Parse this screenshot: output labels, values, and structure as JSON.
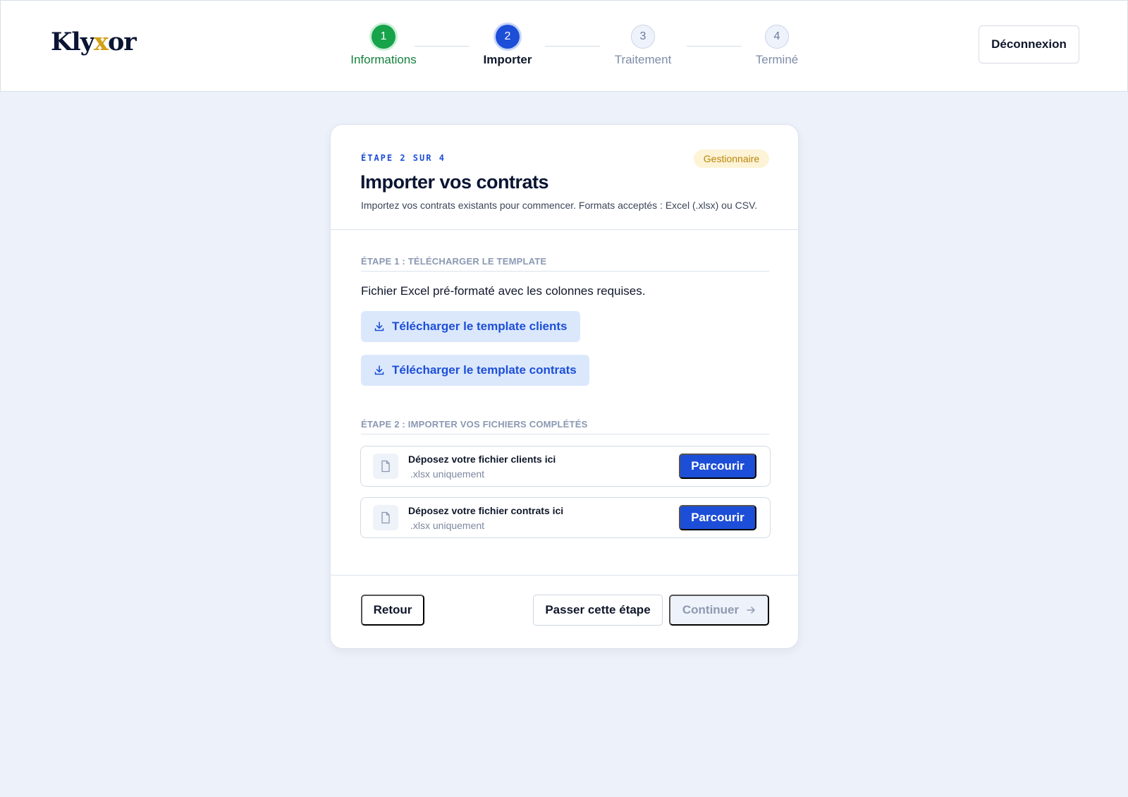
{
  "header": {
    "logo": {
      "part1": "Kly",
      "part2": "x",
      "part3": "or"
    },
    "logout_label": "Déconnexion",
    "steps": [
      {
        "number": "1",
        "label": "Informations",
        "state": "done"
      },
      {
        "number": "2",
        "label": "Importer",
        "state": "active"
      },
      {
        "number": "3",
        "label": "Traitement",
        "state": "todo"
      },
      {
        "number": "4",
        "label": "Terminé",
        "state": "todo"
      }
    ]
  },
  "card": {
    "eyebrow": "ÉTAPE 2 SUR 4",
    "role_badge": "Gestionnaire",
    "title": "Importer vos contrats",
    "description": "Importez vos contrats existants pour commencer. Formats acceptés : Excel (.xlsx) ou CSV.",
    "section1": {
      "label": "ÉTAPE 1 : TÉLÉCHARGER LE TEMPLATE",
      "text": "Fichier Excel pré-formaté avec les colonnes requises.",
      "buttons": [
        {
          "label": "Télécharger le template clients",
          "icon": "download-icon"
        },
        {
          "label": "Télécharger le template contrats",
          "icon": "download-icon"
        }
      ]
    },
    "section2": {
      "label": "ÉTAPE 2 : IMPORTER VOS FICHIERS COMPLÉTÉS",
      "dropzones": [
        {
          "title": "Déposez votre fichier clients ici",
          "subtitle": ".xlsx uniquement",
          "button": "Parcourir",
          "icon": "file-icon"
        },
        {
          "title": "Déposez votre fichier contrats ici",
          "subtitle": ".xlsx uniquement",
          "button": "Parcourir",
          "icon": "file-icon"
        }
      ]
    },
    "footer": {
      "back_label": "Retour",
      "skip_label": "Passer cette étape",
      "continue_label": "Continuer",
      "continue_icon": "arrow-right-icon"
    }
  },
  "colors": {
    "background": "#edf1fa",
    "primary": "#1d4ed8",
    "success": "#16a34a",
    "brand_accent": "#d4a017",
    "badge_bg": "#fdf3d6"
  }
}
